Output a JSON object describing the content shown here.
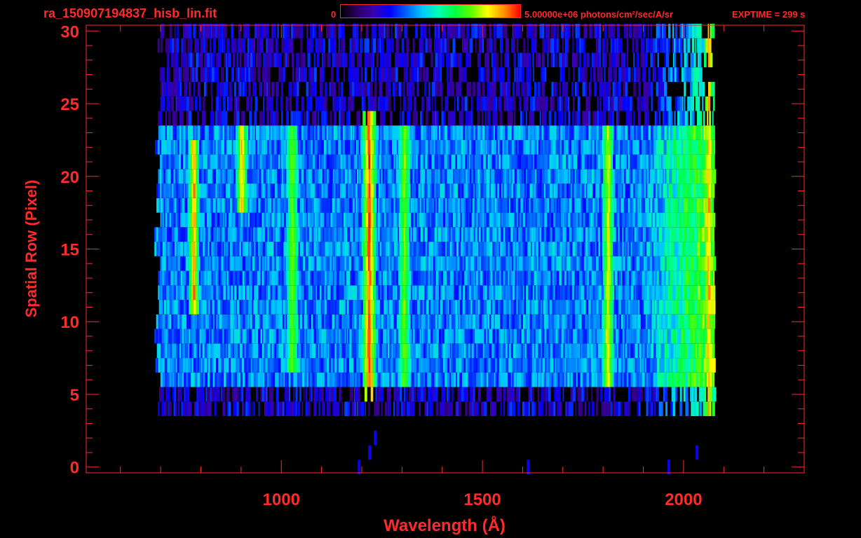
{
  "header": {
    "file_name": "ra_150907194837_hisb_lin.fit",
    "colorbar_min_label": "0",
    "colorbar_max_label": "5.00000e+06 photons/cm²/sec/A/sr",
    "exptime_label": "EXPTIME = 299 s"
  },
  "colors": {
    "background": "#000000",
    "axes": "#ff2a2a",
    "colormap": [
      "#000000",
      "#2a0060",
      "#3a00b0",
      "#0000ff",
      "#0060ff",
      "#00c8ff",
      "#00ffb0",
      "#00ff40",
      "#60ff00",
      "#ffff00",
      "#ff9000",
      "#ff0000"
    ]
  },
  "chart_data": {
    "type": "heatmap",
    "title": "",
    "xlabel": "Wavelength (Å)",
    "ylabel": "Spatial Row (Pixel)",
    "xlim": [
      515,
      2300
    ],
    "ylim": [
      -0.4,
      30.4
    ],
    "x_ticks": [
      1000,
      1500,
      2000
    ],
    "x_tick_labels": [
      "1000",
      "1500",
      "2000"
    ],
    "y_ticks": [
      0,
      5,
      10,
      15,
      20,
      25,
      30
    ],
    "y_tick_labels": [
      "0",
      "5",
      "10",
      "15",
      "20",
      "25",
      "30"
    ],
    "x_minor_step": 100,
    "y_minor_step": 1,
    "grid": false,
    "data_extent": {
      "x": [
        680,
        2075
      ],
      "rows_with_signal": [
        4,
        30
      ]
    },
    "colorbar": {
      "min": 0,
      "max": 5000000,
      "units": "photons/cm²/sec/A/sr"
    },
    "features": [
      {
        "wavelength": 1216,
        "rows": [
          5,
          24
        ],
        "relative_intensity": 1.0
      },
      {
        "wavelength": 1304,
        "rows": [
          6,
          23
        ],
        "relative_intensity": 0.5
      },
      {
        "wavelength": 1025,
        "rows": [
          7,
          23
        ],
        "relative_intensity": 0.5
      },
      {
        "wavelength": 1810,
        "rows": [
          6,
          23
        ],
        "relative_intensity": 0.7
      },
      {
        "wavelength": 2060,
        "rows": [
          4,
          30
        ],
        "relative_intensity": 0.8
      },
      {
        "wavelength": 780,
        "rows": [
          11,
          22
        ],
        "relative_intensity": 0.85
      },
      {
        "wavelength": 900,
        "rows": [
          18,
          23
        ],
        "relative_intensity": 0.8
      }
    ]
  }
}
